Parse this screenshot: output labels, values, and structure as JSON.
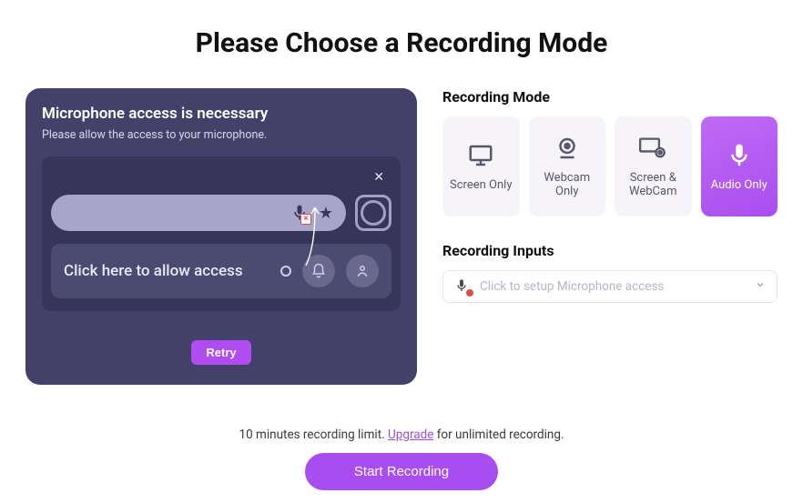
{
  "title": "Please Choose a Recording Mode",
  "micCard": {
    "title": "Microphone access is necessary",
    "subtitle": "Please allow the access to your microphone.",
    "allowLabel": "Click here to allow access",
    "retryLabel": "Retry"
  },
  "sections": {
    "modeTitle": "Recording Mode",
    "inputsTitle": "Recording Inputs"
  },
  "modes": [
    {
      "id": "screen-only",
      "label": "Screen Only",
      "active": false
    },
    {
      "id": "webcam-only",
      "label": "Webcam Only",
      "active": false
    },
    {
      "id": "screen-webcam",
      "label": "Screen & WebCam",
      "active": false
    },
    {
      "id": "audio-only",
      "label": "Audio Only",
      "active": true
    }
  ],
  "inputSelect": {
    "placeholder": "Click to setup Microphone access"
  },
  "footer": {
    "prefix": "10 minutes recording limit. ",
    "link": "Upgrade",
    "suffix": " for unlimited recording.",
    "startLabel": "Start Recording"
  },
  "colors": {
    "accent": "#a84ef0",
    "panel": "#43416a"
  }
}
